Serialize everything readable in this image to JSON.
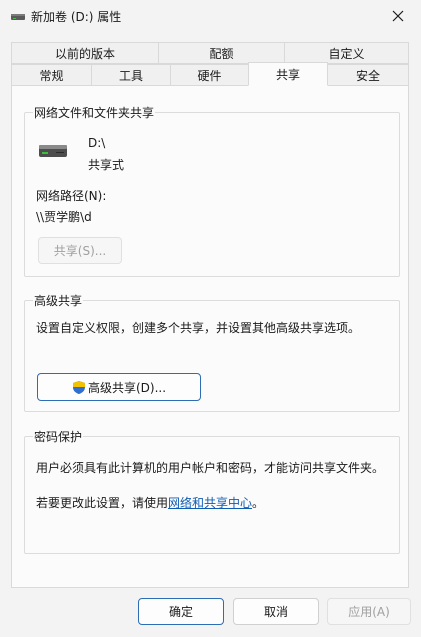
{
  "window": {
    "title": "新加卷 (D:) 属性"
  },
  "tabs_row1": [
    {
      "label": "以前的版本"
    },
    {
      "label": "配额"
    },
    {
      "label": "自定义"
    }
  ],
  "tabs_row2": [
    {
      "label": "常规"
    },
    {
      "label": "工具"
    },
    {
      "label": "硬件"
    },
    {
      "label": "共享"
    },
    {
      "label": "安全"
    }
  ],
  "active_tab": "共享",
  "network_sharing": {
    "group_label": "网络文件和文件夹共享",
    "drive_name": "D:\\",
    "drive_status": "共享式",
    "path_label": "网络路径(N):",
    "path_value": "\\\\贾学鹏\\d",
    "share_button": "共享(S)..."
  },
  "advanced_sharing": {
    "group_label": "高级共享",
    "description": "设置自定义权限，创建多个共享，并设置其他高级共享选项。",
    "button": "高级共享(D)..."
  },
  "password_protection": {
    "group_label": "密码保护",
    "description": "用户必须具有此计算机的用户帐户和密码，才能访问共享文件夹。",
    "change_prefix": "若要更改此设置，请使用",
    "change_link": "网络和共享中心",
    "change_suffix": "。"
  },
  "footer": {
    "ok": "确定",
    "cancel": "取消",
    "apply": "应用(A)"
  },
  "colors": {
    "accent": "#0f5cb5",
    "shield_blue": "#2f6fd1",
    "shield_yellow": "#f2c200"
  }
}
